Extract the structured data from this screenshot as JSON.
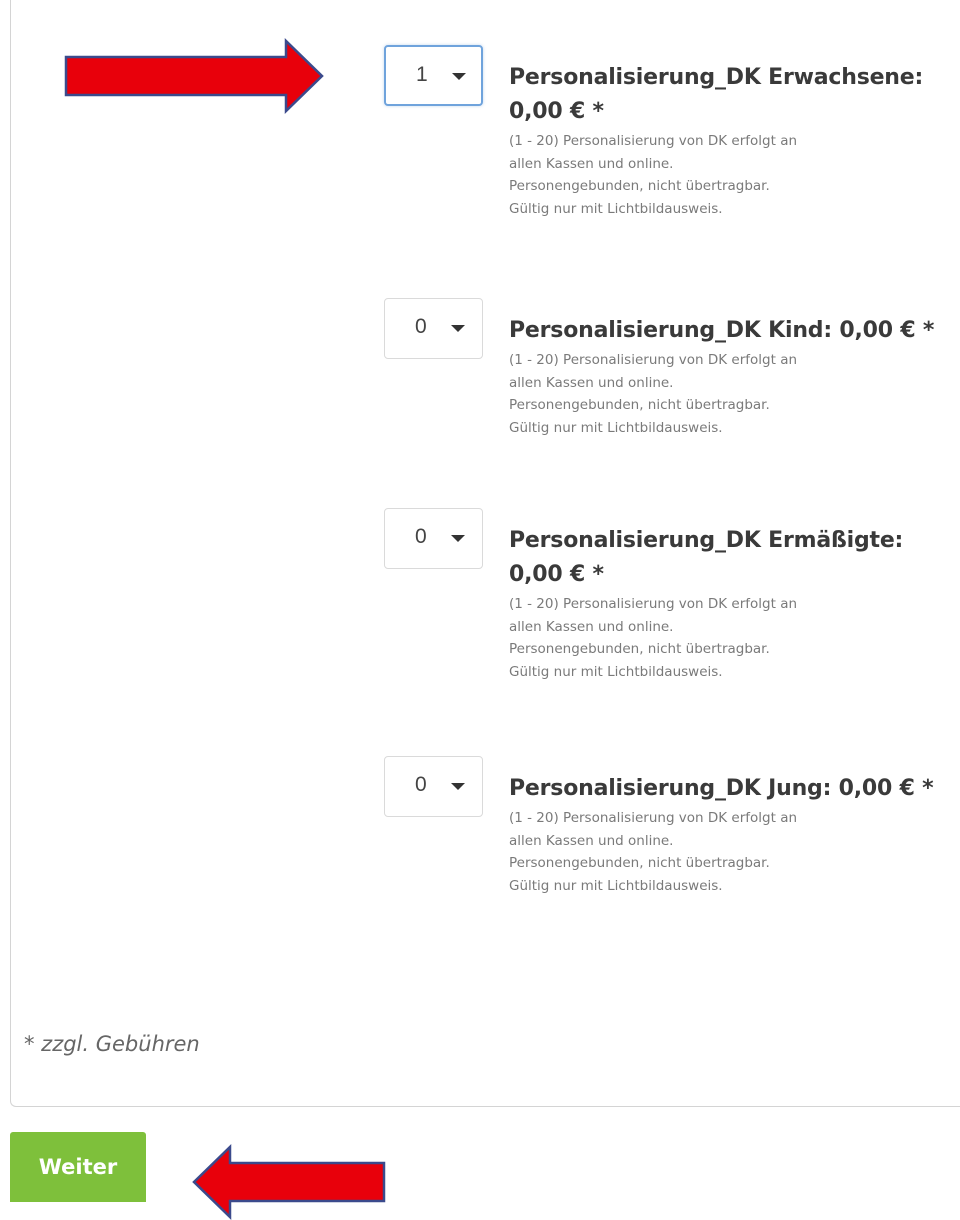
{
  "tickets": [
    {
      "quantity": "1",
      "name_line1": "Personalisierung_DK Erwachsene:",
      "name_line2": "0,00 € *",
      "desc": [
        "(1 - 20) Personalisierung von DK erfolgt an",
        "allen Kassen und online.",
        "Personengebunden, nicht übertragbar.",
        "Gültig nur mit Lichtbildausweis."
      ]
    },
    {
      "quantity": "0",
      "name_line1": "Personalisierung_DK Kind: 0,00 € *",
      "name_line2": "",
      "desc": [
        "(1 - 20) Personalisierung von DK erfolgt an",
        "allen Kassen und online.",
        "Personengebunden, nicht übertragbar.",
        "Gültig nur mit Lichtbildausweis."
      ]
    },
    {
      "quantity": "0",
      "name_line1": "Personalisierung_DK Ermäßigte:",
      "name_line2": "0,00 € *",
      "desc": [
        "(1 - 20) Personalisierung von DK erfolgt an",
        "allen Kassen und online.",
        "Personengebunden, nicht übertragbar.",
        "Gültig nur mit Lichtbildausweis."
      ]
    },
    {
      "quantity": "0",
      "name_line1": "Personalisierung_DK Jung: 0,00 € *",
      "name_line2": "",
      "desc": [
        "(1 - 20) Personalisierung von DK erfolgt an",
        "allen Kassen und online.",
        "Personengebunden, nicht übertragbar.",
        "Gültig nur mit Lichtbildausweis."
      ]
    }
  ],
  "fee_note": "* zzgl. Gebühren",
  "next_button_label": "Weiter",
  "colors": {
    "button_green": "#7ec03b",
    "arrow_red": "#e8000b",
    "arrow_outline": "#3b4a8c",
    "focus_border": "#6fa3dc"
  }
}
